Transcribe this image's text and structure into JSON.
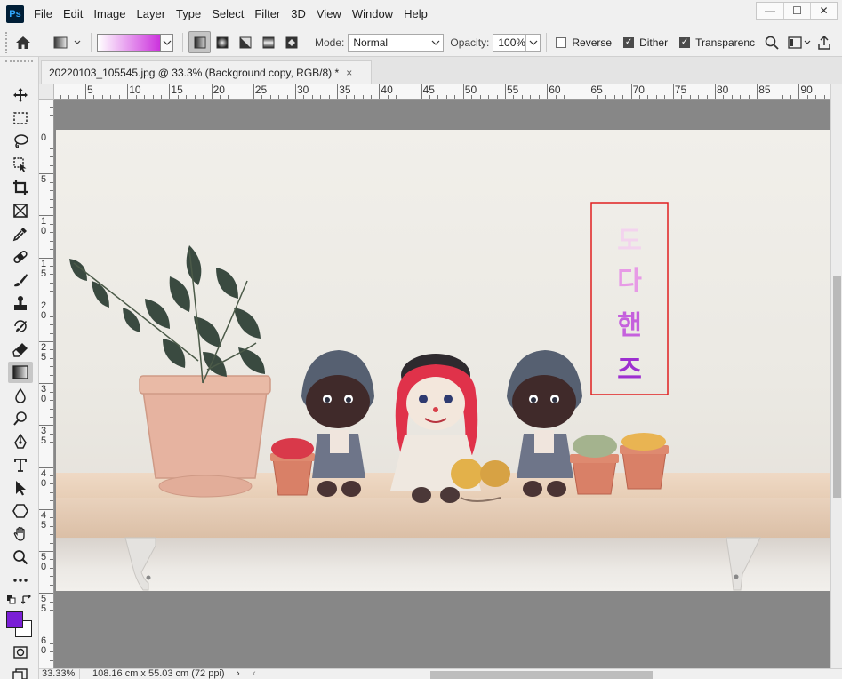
{
  "app": {
    "logo_text": "Ps"
  },
  "menu": {
    "items": [
      "File",
      "Edit",
      "Image",
      "Layer",
      "Type",
      "Select",
      "Filter",
      "3D",
      "View",
      "Window",
      "Help"
    ]
  },
  "window_controls": {
    "minimize": "—",
    "maximize": "☐",
    "close": "✕"
  },
  "options_bar": {
    "gradient_preview": {
      "from_color": "#ffffff",
      "to_color": "#cc33dd"
    },
    "mode_label": "Mode:",
    "mode_value": "Normal",
    "opacity_label": "Opacity:",
    "opacity_value": "100%",
    "reverse": {
      "label": "Reverse",
      "checked": false
    },
    "dither": {
      "label": "Dither",
      "checked": true
    },
    "transparency": {
      "label": "Transparenc",
      "checked": true
    }
  },
  "document": {
    "tab_title": "20220103_105545.jpg @ 33.3% (Background copy, RGB/8) *",
    "tab_close": "×"
  },
  "rulers": {
    "horizontal_labels": [
      "5",
      "10",
      "15",
      "20",
      "25",
      "30",
      "35",
      "40",
      "45",
      "50",
      "55",
      "60",
      "65",
      "70",
      "75",
      "80",
      "85",
      "90"
    ],
    "vertical_labels": [
      [
        "0"
      ],
      [
        "5"
      ],
      [
        "1",
        "0"
      ],
      [
        "1",
        "5"
      ],
      [
        "2",
        "0"
      ],
      [
        "2",
        "5"
      ],
      [
        "3",
        "0"
      ],
      [
        "3",
        "5"
      ],
      [
        "4",
        "0"
      ],
      [
        "4",
        "5"
      ],
      [
        "5",
        "0"
      ],
      [
        "5",
        "5"
      ],
      [
        "6",
        "0"
      ]
    ]
  },
  "canvas": {
    "text_chars": [
      "도",
      "다",
      "핸",
      "즈"
    ],
    "text_gradient": [
      "#f3d3ee",
      "#e79ae6",
      "#c561dd",
      "#9d2fd0"
    ],
    "selection_color": "#e02020"
  },
  "colors": {
    "foreground": "#7a1fd6",
    "background": "#ffffff"
  },
  "status_bar": {
    "zoom": "33.33%",
    "doc_size": "108.16 cm x 55.03 cm (72 ppi)",
    "arrow": "›",
    "scroll_left": "‹"
  }
}
